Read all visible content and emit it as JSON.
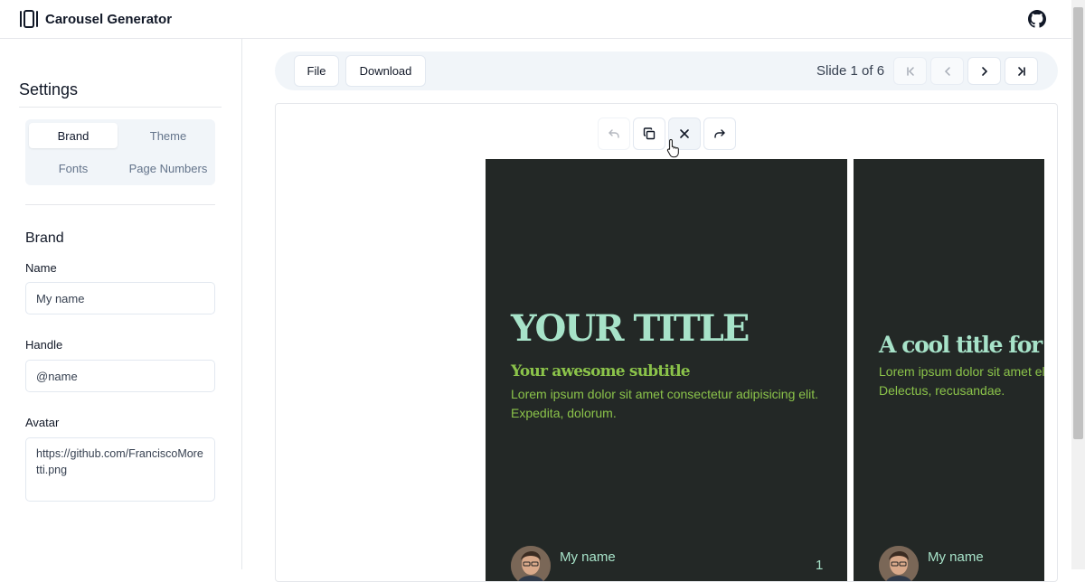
{
  "header": {
    "title": "Carousel Generator",
    "logo_icon": "carousel-icon",
    "github_icon": "github-icon"
  },
  "sidebar": {
    "title": "Settings",
    "tabs": [
      {
        "label": "Brand",
        "active": true
      },
      {
        "label": "Theme",
        "active": false
      },
      {
        "label": "Fonts",
        "active": false
      },
      {
        "label": "Page Numbers",
        "active": false
      }
    ],
    "brand": {
      "section_title": "Brand",
      "name_label": "Name",
      "name_value": "My name",
      "handle_label": "Handle",
      "handle_value": "@name",
      "avatar_label": "Avatar",
      "avatar_value": "https://github.com/FranciscoMoretti.png"
    }
  },
  "toolbar": {
    "file_label": "File",
    "download_label": "Download",
    "slide_status": "Slide 1 of 6",
    "nav": [
      "first-page-icon",
      "chevron-left-icon",
      "chevron-right-icon",
      "last-page-icon"
    ]
  },
  "slide_actions": [
    "undo-icon",
    "copy-icon",
    "close-icon",
    "redo-icon"
  ],
  "slides": [
    {
      "title": "YOUR TITLE",
      "subtitle": "Your awesome subtitle",
      "body": "Lorem ipsum dolor sit amet consectetur adipisicing elit. Expedita, dolorum.",
      "name": "My name",
      "page_number": "1"
    },
    {
      "title": "A cool title for th",
      "body": "Lorem ipsum dolor sit amet elit. Delectus, recusandae.",
      "name": "My name"
    }
  ],
  "colors": {
    "slide_background": "#232826",
    "title": "#a7e3c9",
    "accent": "#8bc34a"
  }
}
